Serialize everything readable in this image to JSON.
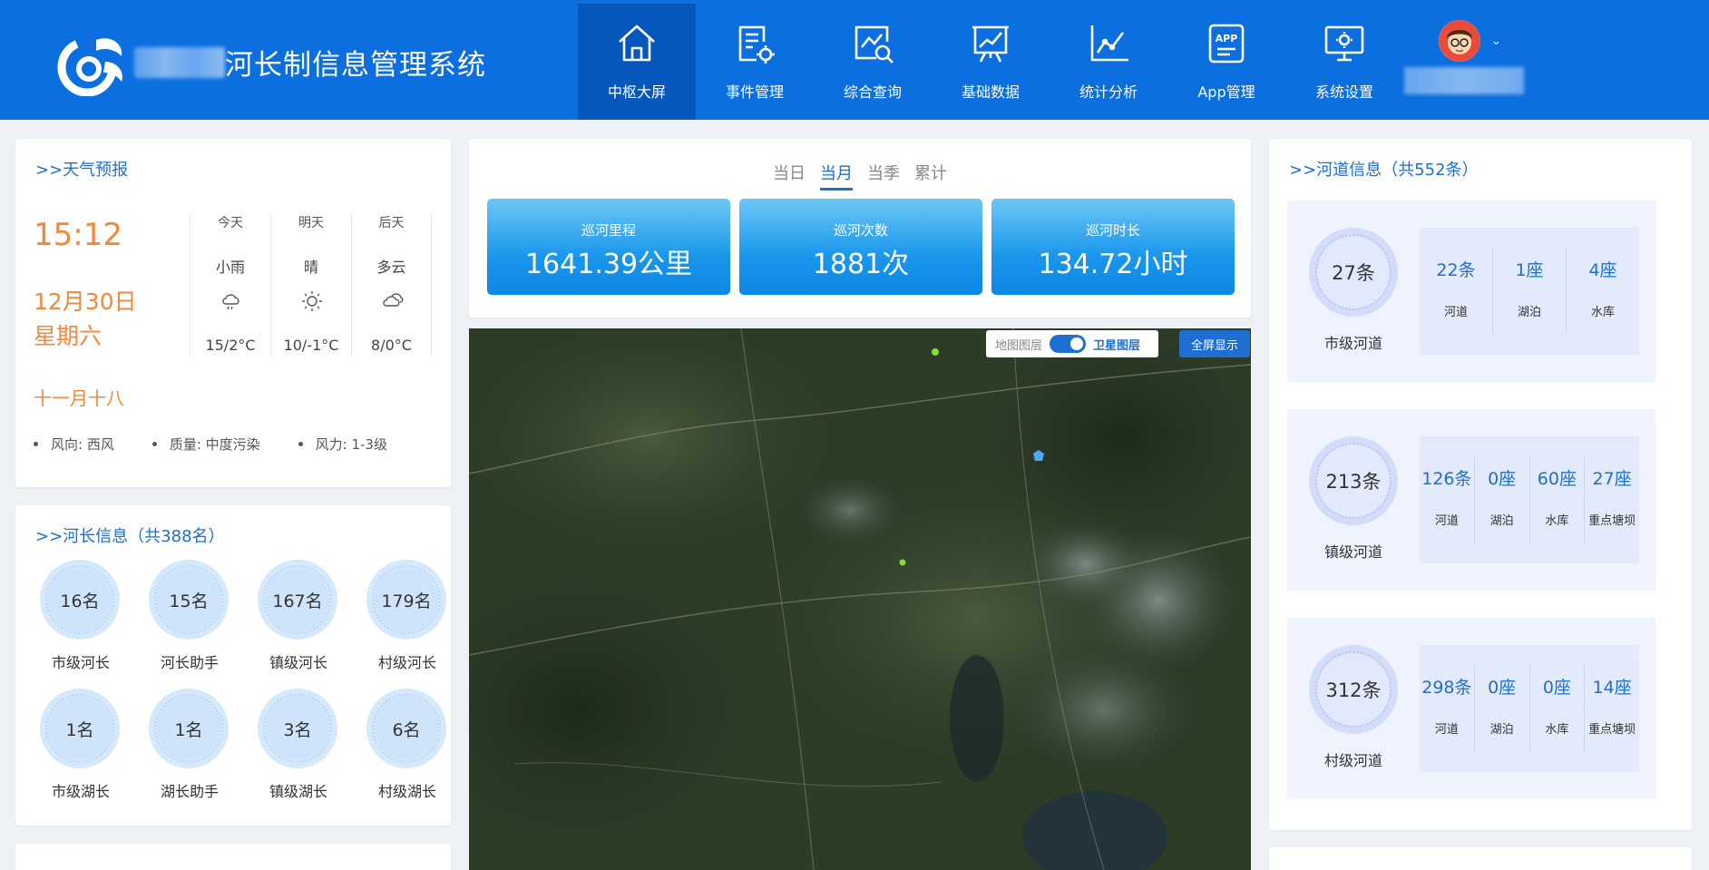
{
  "app": {
    "title": "河长制信息管理系统"
  },
  "nav": [
    {
      "label": "中枢大屏",
      "icon": "home-icon",
      "active": true
    },
    {
      "label": "事件管理",
      "icon": "event-settings-icon"
    },
    {
      "label": "综合查询",
      "icon": "search-chart-icon"
    },
    {
      "label": "基础数据",
      "icon": "presentation-board-icon"
    },
    {
      "label": "统计分析",
      "icon": "line-chart-icon"
    },
    {
      "label": "App管理",
      "icon": "app-icon"
    },
    {
      "label": "系统设置",
      "icon": "monitor-settings-icon"
    }
  ],
  "weather": {
    "title": ">>天气预报",
    "time": "15:12",
    "date": "12月30日",
    "weekday": "星期六",
    "lunar": "十一月十八",
    "days": [
      {
        "day": "今天",
        "cond": "小雨",
        "icon": "rain-cloud-icon",
        "temp": "15/2°C"
      },
      {
        "day": "明天",
        "cond": "晴",
        "icon": "sun-icon",
        "temp": "10/-1°C"
      },
      {
        "day": "后天",
        "cond": "多云",
        "icon": "cloudy-icon",
        "temp": "8/0°C"
      }
    ],
    "stats": [
      "风向: 西风",
      "质量: 中度污染",
      "风力: 1-3级"
    ]
  },
  "chief": {
    "title": ">>河长信息（共388名）",
    "items": [
      {
        "value": "16名",
        "label": "市级河长"
      },
      {
        "value": "15名",
        "label": "河长助手"
      },
      {
        "value": "167名",
        "label": "镇级河长"
      },
      {
        "value": "179名",
        "label": "村级河长"
      },
      {
        "value": "1名",
        "label": "市级湖长"
      },
      {
        "value": "1名",
        "label": "湖长助手"
      },
      {
        "value": "3名",
        "label": "镇级湖长"
      },
      {
        "value": "6名",
        "label": "村级湖长"
      }
    ]
  },
  "patrol": {
    "tabs": [
      "当日",
      "当月",
      "当季",
      "累计"
    ],
    "active_tab": "当月",
    "stats": [
      {
        "label": "巡河里程",
        "value": "1641.39公里"
      },
      {
        "label": "巡河次数",
        "value": "1881次"
      },
      {
        "label": "巡河时长",
        "value": "134.72小时"
      }
    ]
  },
  "map": {
    "layer_label": "地图图层",
    "layer_on": "卫星图层",
    "fullscreen": "全屏显示"
  },
  "river": {
    "title": ">>河道信息（共552条）",
    "blocks": [
      {
        "value": "27条",
        "label": "市级河道",
        "subs": [
          {
            "v": "22条",
            "l": "河道"
          },
          {
            "v": "1座",
            "l": "湖泊"
          },
          {
            "v": "4座",
            "l": "水库"
          }
        ]
      },
      {
        "value": "213条",
        "label": "镇级河道",
        "subs": [
          {
            "v": "126条",
            "l": "河道"
          },
          {
            "v": "0座",
            "l": "湖泊"
          },
          {
            "v": "60座",
            "l": "水库"
          },
          {
            "v": "27座",
            "l": "重点塘坝"
          }
        ]
      },
      {
        "value": "312条",
        "label": "村级河道",
        "subs": [
          {
            "v": "298条",
            "l": "河道"
          },
          {
            "v": "0座",
            "l": "湖泊"
          },
          {
            "v": "0座",
            "l": "水库"
          },
          {
            "v": "14座",
            "l": "重点塘坝"
          }
        ]
      }
    ]
  },
  "colors": {
    "primary": "#0b6fdf",
    "accent": "#1e6fcf",
    "orange": "#f2883a"
  }
}
